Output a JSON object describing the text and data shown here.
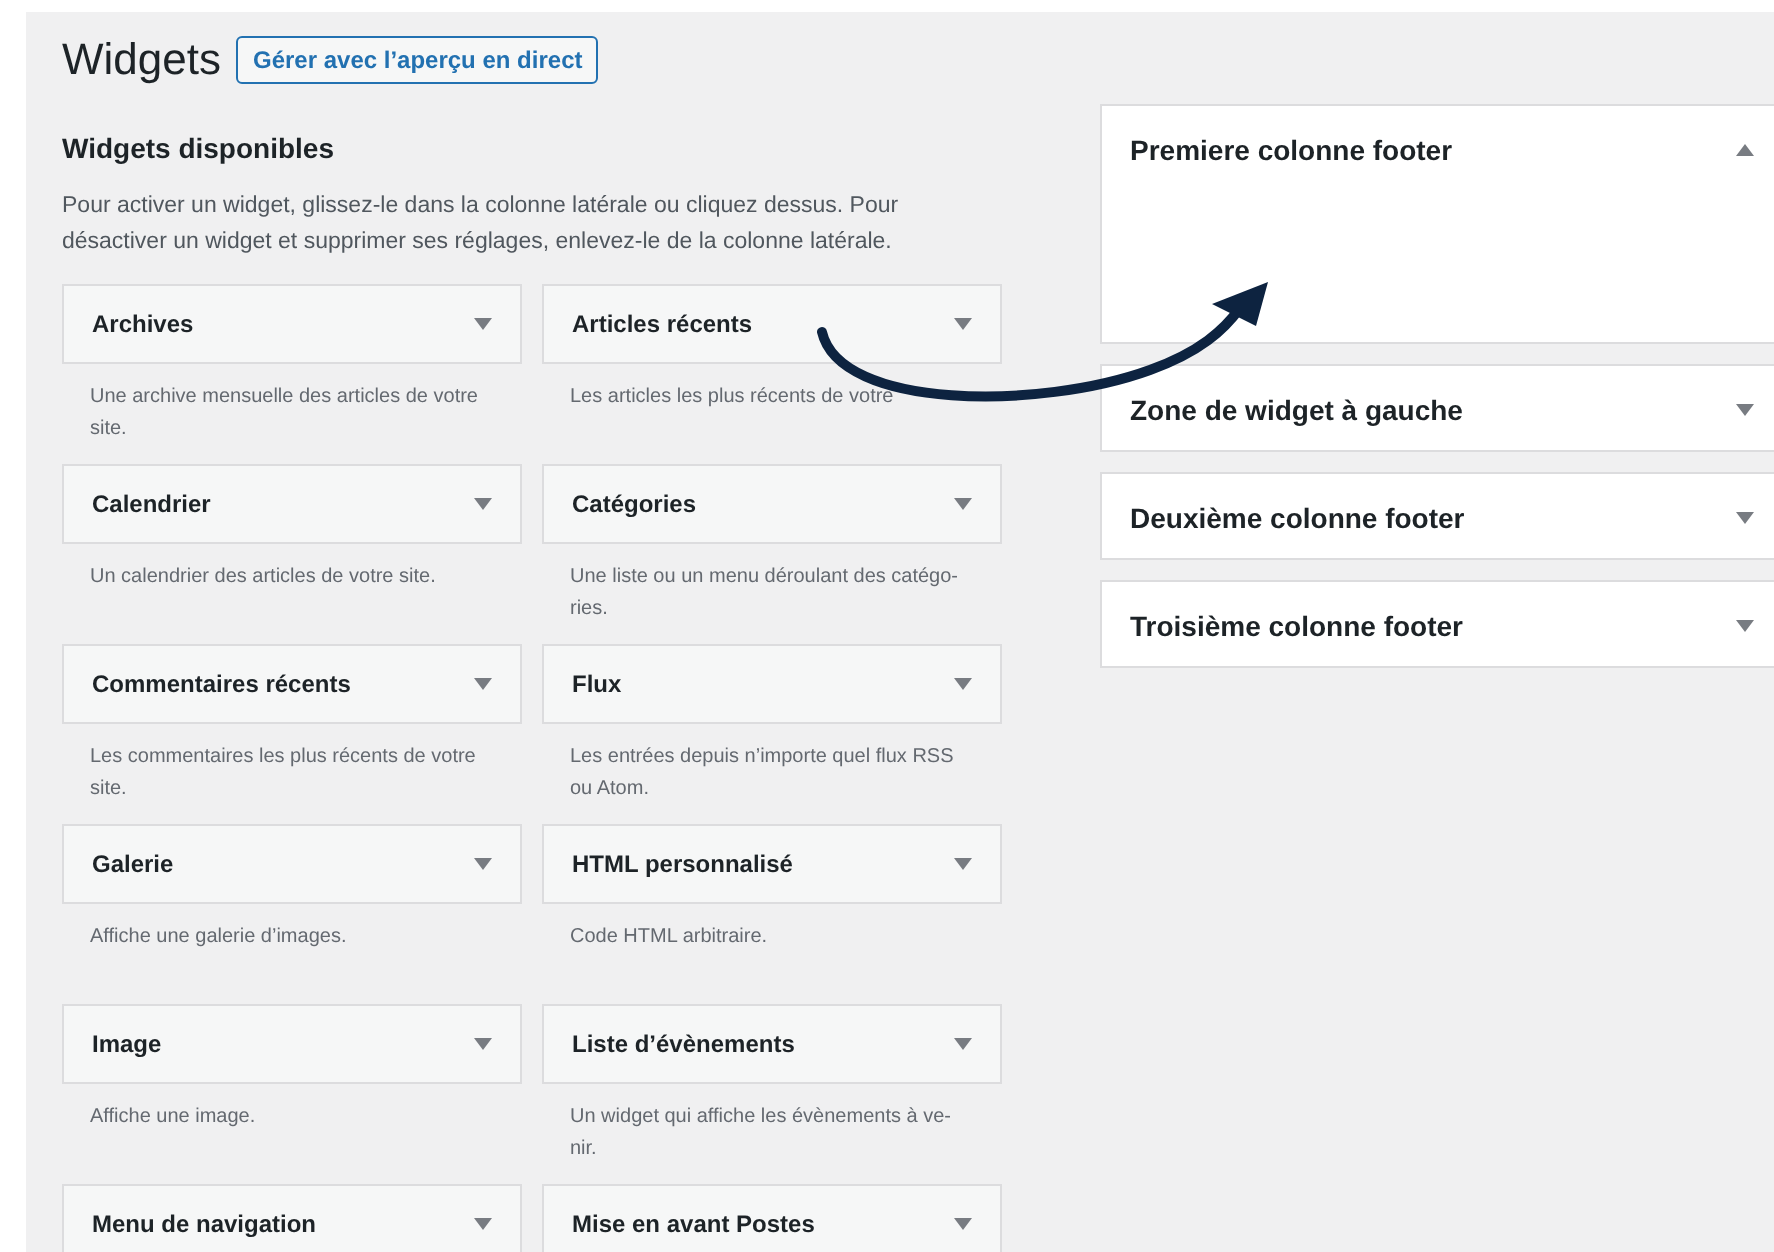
{
  "page": {
    "title": "Widgets",
    "live_preview_button": "Gérer avec l’aperçu en direct"
  },
  "available": {
    "heading": "Widgets disponibles",
    "intro": "Pour activer un widget, glissez-le dans la colonne latérale ou cliquez dessus. Pour désactiver un widget et supprimer ses réglages, enlevez-le de la colonne latérale.",
    "widgets": [
      {
        "name": "Archives",
        "description": "Une archive mensuelle des articles de votre site."
      },
      {
        "name": "Articles récents",
        "description": "Les articles les plus récents de votre"
      },
      {
        "name": "Calendrier",
        "description": "Un calendrier des articles de votre site."
      },
      {
        "name": "Catégories",
        "description": "Une liste ou un menu déroulant des catégo-ries."
      },
      {
        "name": "Commentaires récents",
        "description": "Les commentaires les plus récents de votre site."
      },
      {
        "name": "Flux",
        "description": "Les entrées depuis n’importe quel flux RSS ou Atom."
      },
      {
        "name": "Galerie",
        "description": "Affiche une galerie d’images."
      },
      {
        "name": "HTML personnalisé",
        "description": "Code HTML arbitraire."
      },
      {
        "name": "Image",
        "description": "Affiche une image."
      },
      {
        "name": "Liste d’évènements",
        "description": "Un widget qui affiche les évènements à ve-nir."
      },
      {
        "name": "Menu de navigation"
      },
      {
        "name": "Mise en avant Postes"
      }
    ]
  },
  "sidebars": [
    {
      "name": "Premiere colonne footer",
      "expanded": true
    },
    {
      "name": "Zone de widget à gauche",
      "expanded": false
    },
    {
      "name": "Deuxième colonne footer",
      "expanded": false
    },
    {
      "name": "Troisième colonne footer",
      "expanded": false
    }
  ]
}
